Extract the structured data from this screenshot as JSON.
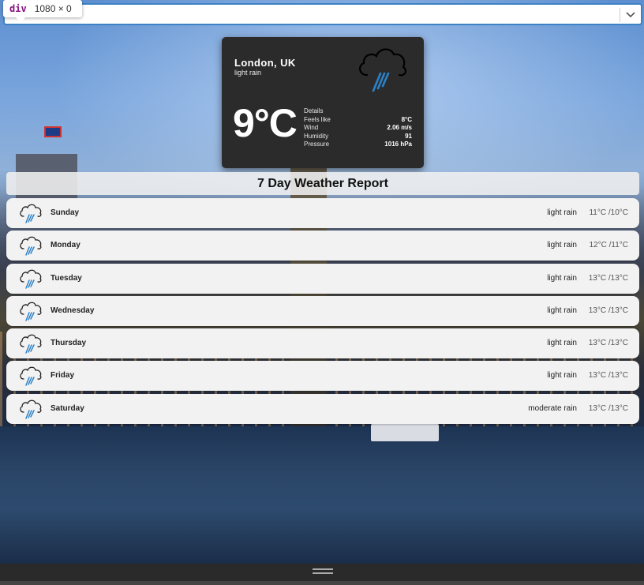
{
  "tooltip": {
    "tag": "div",
    "dims": "1080 × 0"
  },
  "search": {
    "value": ""
  },
  "current": {
    "city": "London, UK",
    "description": "light rain",
    "temperature": "9°C",
    "icon": "rain-cloud-icon",
    "details_heading": "Details",
    "details": [
      {
        "label": "Feels like",
        "value": "8°C"
      },
      {
        "label": "Wind",
        "value": "2.06 m/s"
      },
      {
        "label": "Humidity",
        "value": "91"
      },
      {
        "label": "Pressure",
        "value": "1016 hPa"
      }
    ]
  },
  "report": {
    "title": "7 Day Weather Report"
  },
  "forecast": [
    {
      "day": "Sunday",
      "condition": "light rain",
      "temps": "11°C /10°C",
      "icon": "rain-cloud-icon"
    },
    {
      "day": "Monday",
      "condition": "light rain",
      "temps": "12°C /11°C",
      "icon": "rain-cloud-icon"
    },
    {
      "day": "Tuesday",
      "condition": "light rain",
      "temps": "13°C /13°C",
      "icon": "rain-cloud-icon"
    },
    {
      "day": "Wednesday",
      "condition": "light rain",
      "temps": "13°C /13°C",
      "icon": "rain-cloud-icon"
    },
    {
      "day": "Thursday",
      "condition": "light rain",
      "temps": "13°C /13°C",
      "icon": "rain-cloud-icon"
    },
    {
      "day": "Friday",
      "condition": "light rain",
      "temps": "13°C /13°C",
      "icon": "rain-cloud-icon"
    },
    {
      "day": "Saturday",
      "condition": "moderate rain",
      "temps": "13°C /13°C",
      "icon": "rain-cloud-icon"
    }
  ],
  "colors": {
    "accent": "#3c82c4",
    "rain": "#2b82c9",
    "card_bg": "#2b2b2b"
  }
}
